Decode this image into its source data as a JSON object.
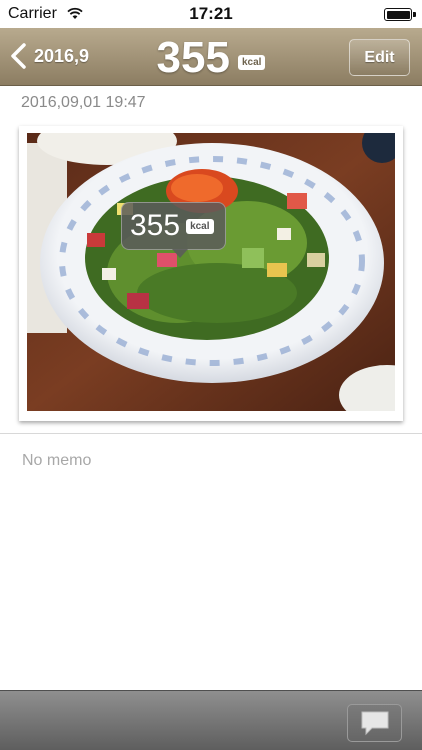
{
  "status_bar": {
    "carrier": "Carrier",
    "time": "17:21",
    "battery_level": 1.0
  },
  "nav": {
    "back_label": "2016,9",
    "title_value": "355",
    "title_unit": "kcal",
    "edit_label": "Edit"
  },
  "entry": {
    "date": "2016,09,01 19:47",
    "photo_icon": "food-photo-salad",
    "calorie_value": "355",
    "calorie_unit": "kcal",
    "memo": "No memo"
  },
  "toolbar": {
    "comment_icon": "speech-bubble-icon"
  },
  "colors": {
    "nav_top": "#b8aa8e",
    "nav_bottom": "#8c7d62",
    "toolbar": "#6e6e6e"
  }
}
